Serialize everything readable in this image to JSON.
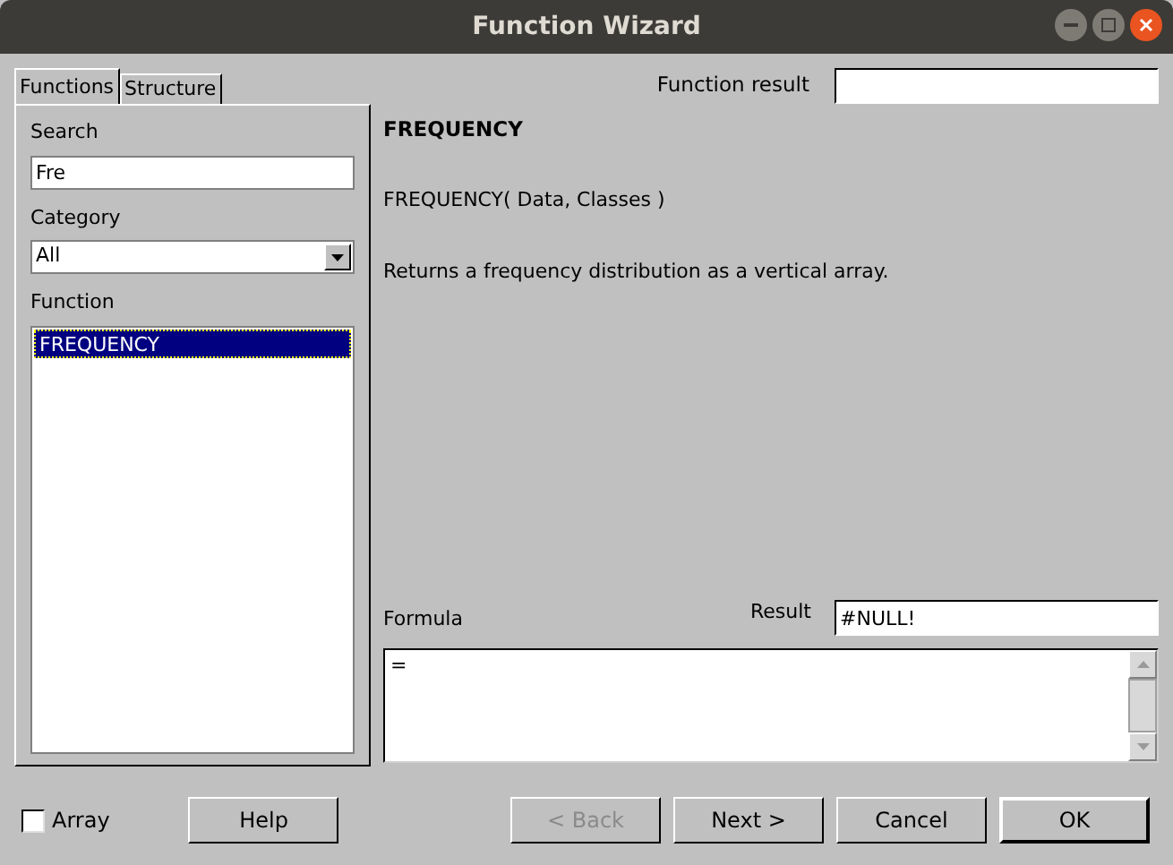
{
  "window": {
    "title": "Function Wizard"
  },
  "tabs": [
    {
      "label": "Functions",
      "selected": true
    },
    {
      "label": "Structure",
      "selected": false
    }
  ],
  "function_result": {
    "label": "Function result"
  },
  "search": {
    "label": "Search",
    "value": "Fre"
  },
  "category": {
    "label": "Category",
    "value": "All"
  },
  "function_list": {
    "label": "Function",
    "items": [
      {
        "label": "FREQUENCY",
        "selected": true
      }
    ]
  },
  "details": {
    "name": "FREQUENCY",
    "signature": "FREQUENCY( Data, Classes )",
    "description": "Returns a frequency distribution as a vertical array."
  },
  "formula": {
    "label": "Formula",
    "value": "="
  },
  "result": {
    "label": "Result",
    "value": "#NULL!"
  },
  "array": {
    "label": "Array",
    "checked": false
  },
  "buttons": [
    {
      "label": "Help",
      "disabled": false,
      "default": false
    },
    {
      "label": "< Back",
      "disabled": true,
      "default": false
    },
    {
      "label": "Next >",
      "disabled": false,
      "default": false
    },
    {
      "label": "Cancel",
      "disabled": false,
      "default": false
    },
    {
      "label": "OK",
      "disabled": false,
      "default": true
    }
  ]
}
